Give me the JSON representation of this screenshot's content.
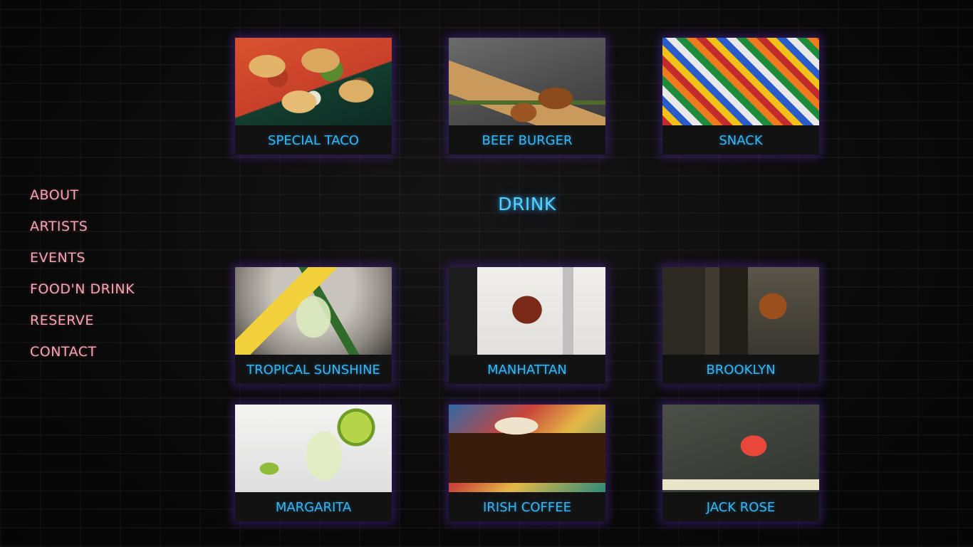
{
  "nav": {
    "items": [
      {
        "label": "ABOUT"
      },
      {
        "label": "ARTISTS"
      },
      {
        "label": "EVENTS"
      },
      {
        "label": "FOOD'N DRINK"
      },
      {
        "label": "RESERVE"
      },
      {
        "label": "CONTACT"
      }
    ]
  },
  "food": {
    "items": [
      {
        "label": "SPECIAL TACO"
      },
      {
        "label": "BEEF BURGER"
      },
      {
        "label": "SNACK"
      }
    ]
  },
  "drink": {
    "title": "DRINK",
    "items": [
      {
        "label": "TROPICAL SUNSHINE"
      },
      {
        "label": "MANHATTAN"
      },
      {
        "label": "BROOKLYN"
      },
      {
        "label": "MARGARITA"
      },
      {
        "label": "IRISH COFFEE"
      },
      {
        "label": "JACK ROSE"
      }
    ]
  },
  "colors": {
    "nav_text": "#f2a5b1",
    "card_label": "#35b7f5",
    "section_title": "#55d2ff",
    "card_glow": "#5a28b4"
  }
}
